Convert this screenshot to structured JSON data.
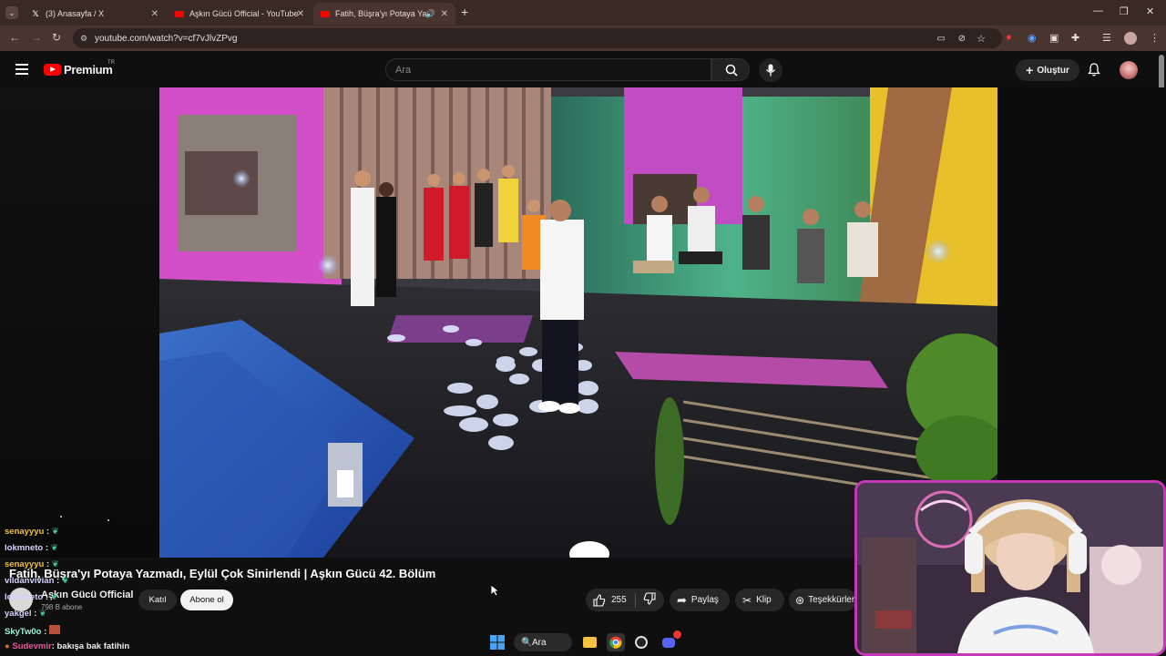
{
  "browser": {
    "tabs": [
      {
        "label": "(3) Anasayfa / X",
        "icon": "x-logo-icon"
      },
      {
        "label": "Aşkın Gücü Official - YouTube",
        "icon": "youtube-favicon-icon"
      },
      {
        "label": "Fatih, Büşra'yı Potaya Yazma",
        "icon": "youtube-favicon-icon",
        "active": true
      }
    ],
    "url": "youtube.com/watch?v=cf7vJlvZPvg"
  },
  "youtube": {
    "logo_text": "Premium",
    "region": "TR",
    "search_placeholder": "Ara",
    "create_label": "Oluştur"
  },
  "video": {
    "title": "Fatih, Büşra'yı Potaya Yazmadı, Eylül Çok Sinirlendi | Aşkın Gücü 42. Bölüm",
    "channel": "Aşkın Gücü Official",
    "subscribers": "798 B abone",
    "join_label": "Katıl",
    "subscribe_label": "Abone ol",
    "likes": "255",
    "share_label": "Paylaş",
    "clip_label": "Klip",
    "thanks_label": "Teşekkürler"
  },
  "chat": [
    {
      "user": "senayyyu",
      "message": ":"
    },
    {
      "user": "lokmneto",
      "message": ":"
    },
    {
      "user": "senayyyu",
      "message": ":"
    },
    {
      "user": "vildanvivian",
      "message": ":"
    },
    {
      "user": "lokmneto",
      "message": ":"
    },
    {
      "user": "yakgel",
      "message": ":"
    },
    {
      "user": "SkyTw0o",
      "message": ":"
    },
    {
      "user": "Sudevmir",
      "message": ": bakışa bak fatihin"
    }
  ],
  "taskbar": {
    "search_label": "Ara"
  }
}
